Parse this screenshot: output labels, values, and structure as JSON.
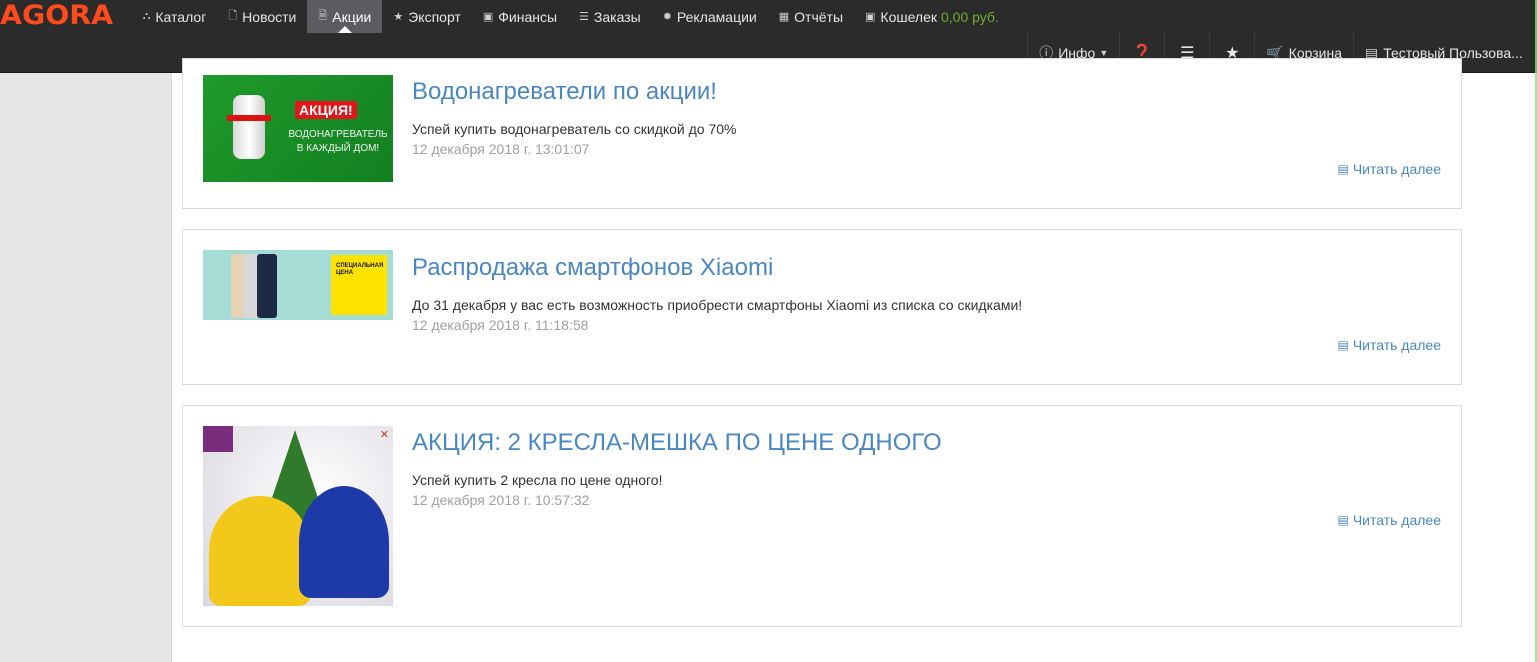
{
  "navbar": {
    "logo": "AGORA",
    "menu": [
      {
        "label": "Каталог",
        "icon": "sitemap-icon",
        "glyph": "⛬"
      },
      {
        "label": "Новости",
        "icon": "file-icon",
        "glyph": "🗋"
      },
      {
        "label": "Акции",
        "icon": "file-text-icon",
        "glyph": "🗎",
        "active": true
      },
      {
        "label": "Экспорт",
        "icon": "star-icon",
        "glyph": "★"
      },
      {
        "label": "Финансы",
        "icon": "money-icon",
        "glyph": "▣"
      },
      {
        "label": "Заказы",
        "icon": "list-icon",
        "glyph": "☰"
      },
      {
        "label": "Рекламации",
        "icon": "gear-icon",
        "glyph": "✹"
      },
      {
        "label": "Отчёты",
        "icon": "table-icon",
        "glyph": "▦"
      },
      {
        "label": "Кошелек",
        "icon": "wallet-icon",
        "glyph": "▣"
      }
    ],
    "wallet_value": "0,00 руб.",
    "right": {
      "info_label": "Инфо",
      "cart_label": "Корзина",
      "user_label": "Тестовый Пользова..."
    }
  },
  "promos": [
    {
      "title": "Водонагреватели по акции!",
      "description": "Успей купить водонагреватель со скидкой до 70%",
      "date": "12 декабря 2018 г. 13:01:07",
      "read_more": "Читать далее",
      "image_text": {
        "badge": "АКЦИЯ!",
        "line1": "ВОДОНАГРЕВАТЕЛЬ",
        "line2": "В КАЖДЫЙ ДОМ!"
      }
    },
    {
      "title": "Распродажа смартфонов Xiaomi",
      "description": "До 31 декабря у вас есть возможность приобрести смартфоны Xiaomi из списка со скидками!",
      "date": "12 декабря 2018 г. 11:18:58",
      "read_more": "Читать далее",
      "image_text": {
        "line1": "СПЕЦИАЛЬНАЯ",
        "line2": "ЦЕНА"
      }
    },
    {
      "title": "АКЦИЯ: 2 КРЕСЛА-МЕШКА ПО ЦЕНЕ ОДНОГО",
      "description": "Успей купить 2 кресла по цене одного!",
      "date": "12 декабря 2018 г. 10:57:32",
      "read_more": "Читать далее"
    }
  ],
  "colors": {
    "navbar_bg": "#2b2b2b",
    "active_tab": "#5a5c61",
    "logo": "#ff4a1c",
    "link": "#4a87c2",
    "wallet": "#6fae2f"
  }
}
